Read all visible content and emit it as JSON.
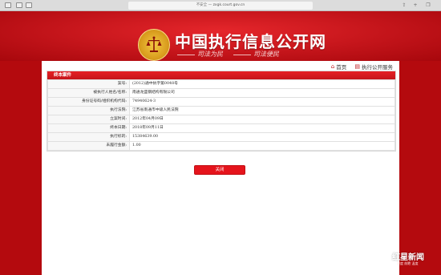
{
  "browser": {
    "url_security": "不安全",
    "url_separator": "—",
    "url": "zxgk.court.gov.cn"
  },
  "header": {
    "site_title": "中国执行信息公开网",
    "slogan_left": "司法为民",
    "slogan_right": "司法便民"
  },
  "nav": {
    "home": "首页",
    "service": "执行公开服务"
  },
  "case": {
    "box_title": "终本案件",
    "rows": [
      {
        "label": "案号:",
        "value": "(2012)通中执字第0048号"
      },
      {
        "label": "被执行人姓名/名称:",
        "value": "南通龙盛钢结构有限公司"
      },
      {
        "label": "身份证号码/组织机构代码:",
        "value": "74940624-3"
      },
      {
        "label": "执行法院:",
        "value": "江苏省南通市中级人民法院"
      },
      {
        "label": "立案时间:",
        "value": "2012年04月09日"
      },
      {
        "label": "终本日期:",
        "value": "2018年09月11日"
      },
      {
        "label": "执行标的:",
        "value": "15384639.00"
      },
      {
        "label": "未履行金额:",
        "value": "1.00"
      }
    ]
  },
  "close_label": "关闭",
  "watermark": {
    "main": "红星新闻",
    "sub": "深度 前瞻 温度"
  },
  "colors": {
    "brand_red": "#c3141a",
    "button_red": "#e5141c"
  }
}
